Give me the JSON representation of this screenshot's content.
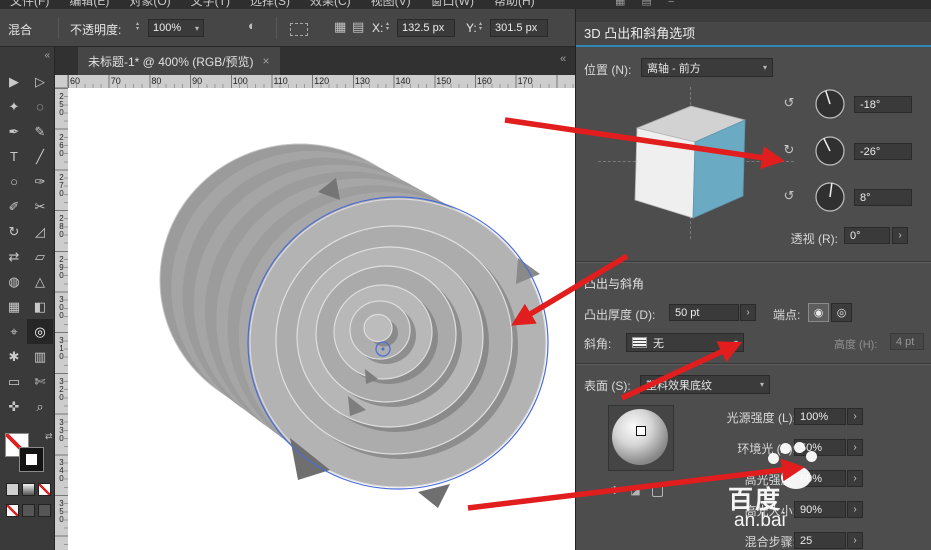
{
  "menu": {
    "items": [
      "文件(F)",
      "编辑(E)",
      "对象(O)",
      "文字(T)",
      "选择(S)",
      "效果(C)",
      "视图(V)",
      "窗口(W)",
      "帮助(H)"
    ],
    "extra_icons": [
      "▦",
      "▤",
      "≡"
    ]
  },
  "control_bar": {
    "mode_label": "混合",
    "opacity_label": "不透明度:",
    "opacity_value": "100%",
    "x_label": "X:",
    "x_value": "132.5 px",
    "y_label": "Y:",
    "y_value": "301.5 px"
  },
  "tab": {
    "title": "未标题-1* @ 400% (RGB/预览)",
    "close": "×"
  },
  "ruler": {
    "h": [
      "60",
      "70",
      "80",
      "90",
      "100",
      "110",
      "120",
      "130",
      "140",
      "150",
      "160",
      "170"
    ],
    "v": [
      "250",
      "260",
      "270",
      "280",
      "290",
      "300",
      "310",
      "320",
      "330",
      "340",
      "350"
    ]
  },
  "toolbar": {
    "collapse": "«",
    "tools": [
      {
        "n": "selection-tool",
        "g": "▶",
        "c": "tool"
      },
      {
        "n": "direct-selection-tool",
        "g": "▷",
        "c": "tool"
      },
      {
        "n": "magic-wand-tool",
        "g": "✦",
        "c": "tool"
      },
      {
        "n": "lasso-tool",
        "g": "◌",
        "c": "tool"
      },
      {
        "n": "pen-tool",
        "g": "✒",
        "c": "tool"
      },
      {
        "n": "curvature-tool",
        "g": "✎",
        "c": "tool"
      },
      {
        "n": "type-tool",
        "g": "T",
        "c": "tool"
      },
      {
        "n": "line-tool",
        "g": "╱",
        "c": "tool"
      },
      {
        "n": "ellipse-tool",
        "g": "○",
        "c": "tool"
      },
      {
        "n": "paintbrush-tool",
        "g": "✑",
        "c": "tool"
      },
      {
        "n": "pencil-tool",
        "g": "✐",
        "c": "tool"
      },
      {
        "n": "scissors-tool",
        "g": "✂",
        "c": "tool"
      },
      {
        "n": "rotate-tool",
        "g": "↻",
        "c": "tool"
      },
      {
        "n": "scale-tool",
        "g": "◿",
        "c": "tool"
      },
      {
        "n": "width-tool",
        "g": "⇄",
        "c": "tool"
      },
      {
        "n": "free-transform-tool",
        "g": "▱",
        "c": "tool"
      },
      {
        "n": "shape-builder-tool",
        "g": "◍",
        "c": "tool"
      },
      {
        "n": "perspective-grid-tool",
        "g": "△",
        "c": "tool"
      },
      {
        "n": "mesh-tool",
        "g": "▦",
        "c": "tool"
      },
      {
        "n": "gradient-tool",
        "g": "◧",
        "c": "tool"
      },
      {
        "n": "eyedropper-tool",
        "g": "⌖",
        "c": "tool"
      },
      {
        "n": "blend-tool",
        "g": "◎",
        "c": "tool active"
      },
      {
        "n": "symbol-sprayer-tool",
        "g": "✱",
        "c": "tool"
      },
      {
        "n": "column-graph-tool",
        "g": "▥",
        "c": "tool"
      },
      {
        "n": "artboard-tool",
        "g": "▭",
        "c": "tool"
      },
      {
        "n": "slice-tool",
        "g": "✄",
        "c": "tool"
      },
      {
        "n": "hand-tool",
        "g": "✜",
        "c": "tool"
      },
      {
        "n": "zoom-tool",
        "g": "⌕",
        "c": "tool"
      }
    ]
  },
  "dialog": {
    "title": "3D 凸出和斜角选项",
    "position_label": "位置 (N):",
    "position_value": "离轴 - 前方",
    "rotate_x_value": "-18°",
    "rotate_y_value": "-26°",
    "rotate_z_value": "8°",
    "perspective_label": "透视 (R):",
    "perspective_value": "0°",
    "section_extrude": "凸出与斜角",
    "depth_label": "凸出厚度 (D):",
    "depth_value": "50 pt",
    "caps_label": "端点:",
    "bevel_label": "斜角:",
    "bevel_value": "无",
    "height_label": "高度 (H):",
    "height_value": "4 pt",
    "surface_label": "表面 (S):",
    "surface_value": "塑料效果底纹",
    "lighting": [
      {
        "label": "光源强度 (L):",
        "value": "100%"
      },
      {
        "label": "环境光 (A):",
        "value": "50%"
      },
      {
        "label": "高光强度:",
        "value": "60%"
      },
      {
        "label": "高光大小:",
        "value": "90%"
      },
      {
        "label": "混合步骤:",
        "value": "25"
      }
    ]
  },
  "watermark": {
    "cn": "百度",
    "en": "an.bai"
  },
  "icons": {
    "chevron_down": "▾",
    "spin": "›",
    "stepper_up": "▴",
    "stepper_down": "▾",
    "globe": "◐",
    "grid": "▦",
    "grid2": "▤",
    "swap": "⇄",
    "collapse": "«",
    "cap_solid": "◉",
    "cap_hollow": "◎",
    "rotate_x": "↺",
    "rotate_y": "↻",
    "rotate_z": "↺",
    "new_light": "✱",
    "light_back": "◪"
  },
  "colors": {
    "arrow_red": "#e11d1d",
    "selection_blue": "#4a6cd8",
    "cube_face_blue": "#6aaac3",
    "header_accent": "#2e86b5"
  }
}
